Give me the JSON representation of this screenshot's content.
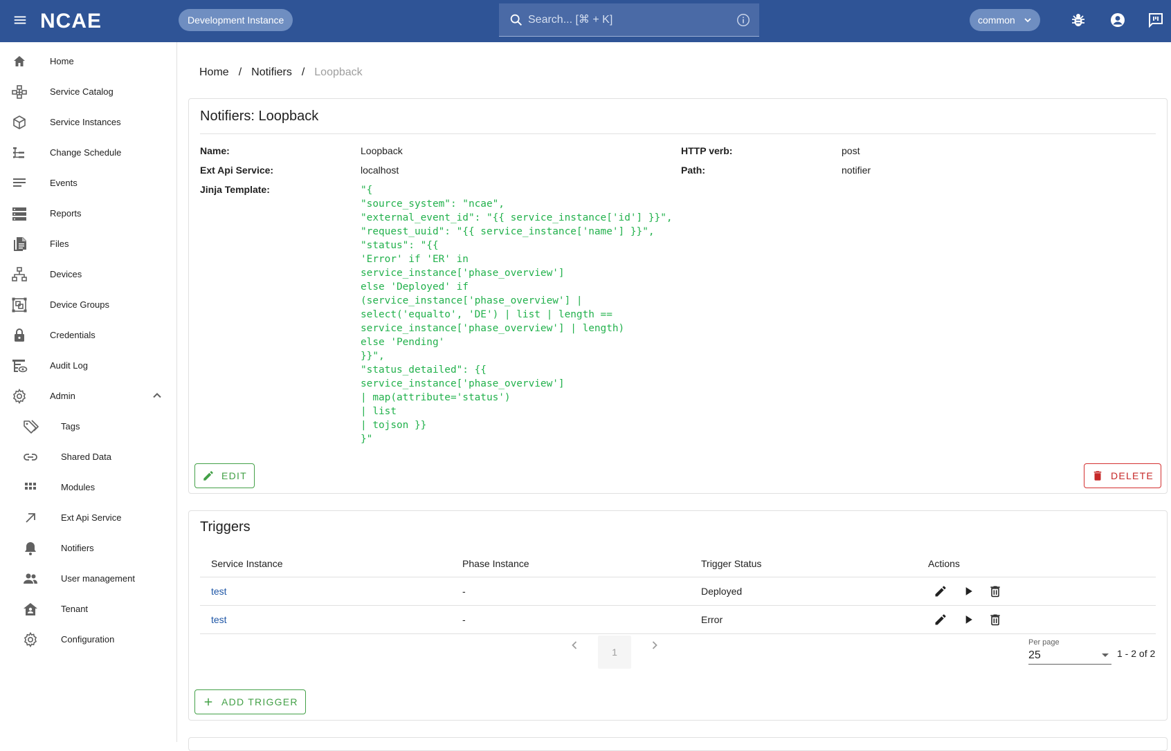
{
  "app": {
    "logo": "NCAE",
    "instance": "Development Instance",
    "search_placeholder": "Search... [⌘ + K]",
    "tenant": "common"
  },
  "sidebar": {
    "items": [
      {
        "label": "Home",
        "icon": "home-icon"
      },
      {
        "label": "Service Catalog",
        "icon": "catalog-icon"
      },
      {
        "label": "Service Instances",
        "icon": "cube-icon"
      },
      {
        "label": "Change Schedule",
        "icon": "schedule-icon"
      },
      {
        "label": "Events",
        "icon": "events-icon"
      },
      {
        "label": "Reports",
        "icon": "reports-icon"
      },
      {
        "label": "Files",
        "icon": "files-icon"
      },
      {
        "label": "Devices",
        "icon": "devices-icon"
      },
      {
        "label": "Device Groups",
        "icon": "device-groups-icon"
      },
      {
        "label": "Credentials",
        "icon": "lock-icon"
      },
      {
        "label": "Audit Log",
        "icon": "audit-log-icon"
      },
      {
        "label": "Admin",
        "icon": "gear-icon"
      }
    ],
    "admin_items": [
      {
        "label": "Tags",
        "icon": "tag-icon"
      },
      {
        "label": "Shared Data",
        "icon": "link-icon"
      },
      {
        "label": "Modules",
        "icon": "grid-icon"
      },
      {
        "label": "Ext Api Service",
        "icon": "arrow-up-right-icon"
      },
      {
        "label": "Notifiers",
        "icon": "bell-icon"
      },
      {
        "label": "User management",
        "icon": "users-icon"
      },
      {
        "label": "Tenant",
        "icon": "tenant-icon"
      },
      {
        "label": "Configuration",
        "icon": "gear-icon"
      }
    ]
  },
  "breadcrumb": {
    "home": "Home",
    "sep": "/",
    "notifiers": "Notifiers",
    "current": "Loopback"
  },
  "details": {
    "title": "Notifiers: Loopback",
    "name_label": "Name:",
    "name_value": "Loopback",
    "ext_api_label": "Ext Api Service:",
    "ext_api_value": "localhost",
    "jinja_label": "Jinja Template:",
    "http_verb_label": "HTTP verb:",
    "http_verb_value": "post",
    "path_label": "Path:",
    "path_value": "notifier",
    "template": "\"{\n\"source_system\": \"ncae\",\n\"external_event_id\": \"{{ service_instance['id'] }}\",\n\"request_uuid\": \"{{ service_instance['name'] }}\",\n\"status\": \"{{\n'Error' if 'ER' in\nservice_instance['phase_overview']\nelse 'Deployed' if\n(service_instance['phase_overview'] |\nselect('equalto', 'DE') | list | length ==\nservice_instance['phase_overview'] | length)\nelse 'Pending'\n}}\",\n\"status_detailed\": {{\nservice_instance['phase_overview']\n| map(attribute='status')\n| list\n| tojson }}\n}\"",
    "edit_label": "EDIT",
    "delete_label": "DELETE"
  },
  "triggers": {
    "title": "Triggers",
    "columns": [
      "Service Instance",
      "Phase Instance",
      "Trigger Status",
      "Actions"
    ],
    "rows": [
      {
        "service_instance": "test",
        "phase_instance": "-",
        "status": "Deployed"
      },
      {
        "service_instance": "test",
        "phase_instance": "-",
        "status": "Error"
      }
    ],
    "page": "1",
    "per_page_label": "Per page",
    "per_page_value": "25",
    "count_text": "1 - 2 of 2",
    "add_label": "ADD TRIGGER"
  },
  "colors": {
    "topbar": "#2f5496",
    "accent_green": "#43a047",
    "danger_red": "#d32f2f",
    "link_blue": "#1e56a6",
    "code_green": "#22b14c"
  }
}
